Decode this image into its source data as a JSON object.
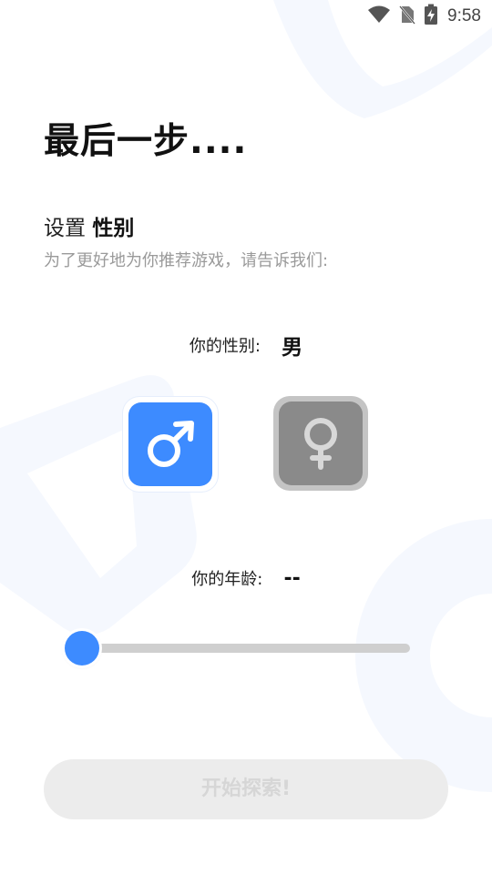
{
  "status_bar": {
    "time": "9:58",
    "icons": [
      "wifi-icon",
      "no-sim-icon",
      "battery-charging-icon"
    ]
  },
  "page": {
    "title": "最后一步....",
    "subtitle_prefix": "设置",
    "subtitle_strong": "性别",
    "description": "为了更好地为你推荐游戏，请告诉我们:"
  },
  "gender": {
    "label": "你的性别:",
    "value": "男",
    "options": [
      {
        "name": "male",
        "icon": "male-symbol-icon",
        "selected": true
      },
      {
        "name": "female",
        "icon": "female-symbol-icon",
        "selected": false
      }
    ]
  },
  "age": {
    "label": "你的年龄:",
    "value": "--",
    "slider_fraction": 0
  },
  "actions": {
    "start_label": "开始探索!",
    "start_enabled": false
  },
  "colors": {
    "accent": "#3d8bff",
    "inactive_gray": "#8a8a8a",
    "track_gray": "#cfcfcf",
    "disabled_button_bg": "#ececec",
    "disabled_button_text": "#d6d6d6",
    "description_text": "#9a9a9a"
  }
}
